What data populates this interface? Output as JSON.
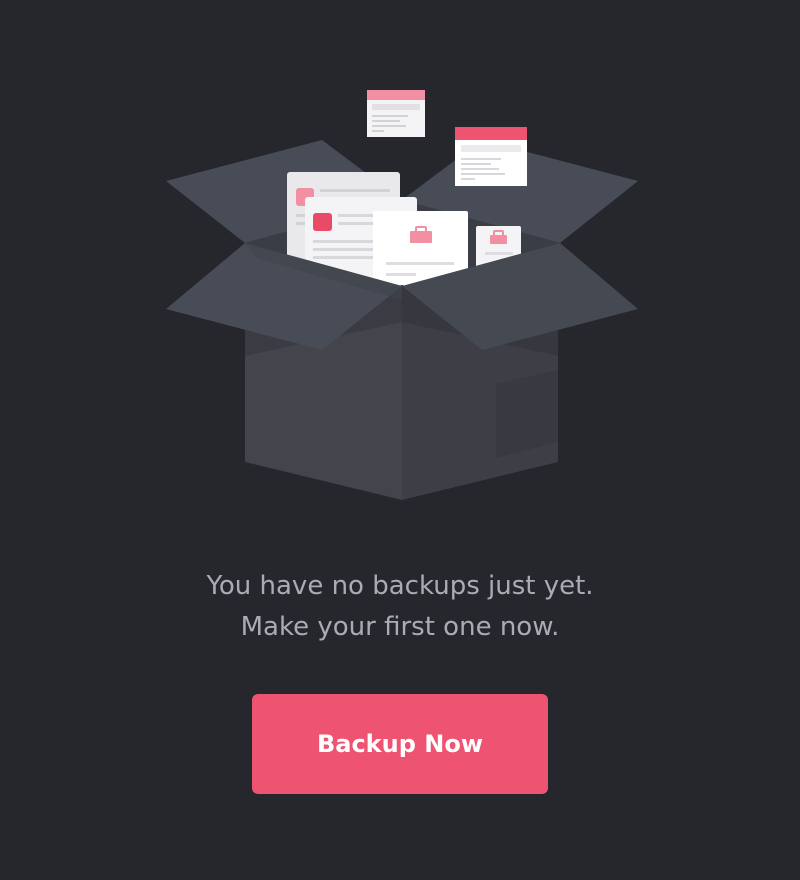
{
  "empty_state": {
    "message_line1": "You have no backups just yet.",
    "message_line2": "Make your first one now."
  },
  "actions": {
    "backup_label": "Backup Now"
  },
  "colors": {
    "background": "#26272c",
    "accent": "#ee5471",
    "text_muted": "#a9acb4",
    "box_flap": "#464b55",
    "box_body": "#404049"
  },
  "illustration": {
    "icon": "open-box-with-documents-icon"
  }
}
